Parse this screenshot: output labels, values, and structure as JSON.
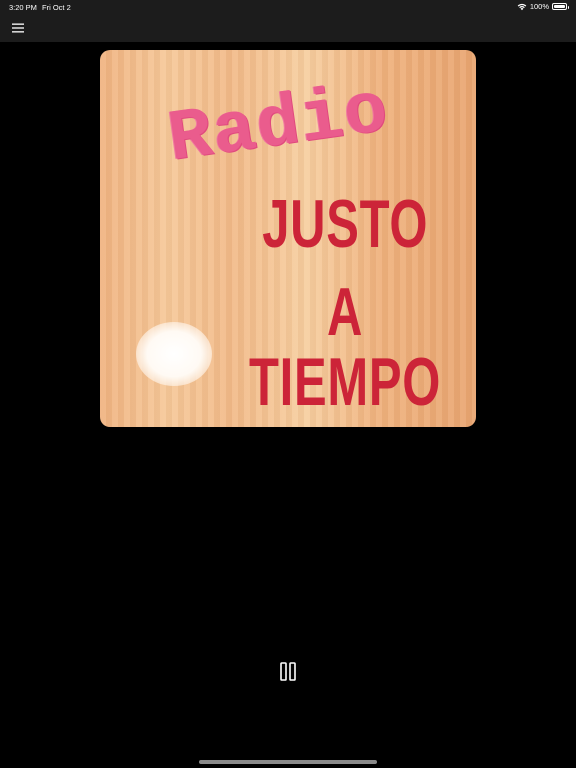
{
  "status_bar": {
    "time": "3:20 PM",
    "date": "Fri Oct 2",
    "battery": "100%",
    "icons": [
      "wifi-icon",
      "battery-icon"
    ]
  },
  "nav": {
    "menu_icon": "hamburger-menu-icon"
  },
  "artwork": {
    "title_word": "Radio",
    "line1": "JUSTO",
    "line2": "A",
    "line3": "TIEMPO"
  },
  "player": {
    "control_icon": "pause-icon"
  },
  "colors": {
    "background": "#000000",
    "bar_background": "#1c1c1c",
    "radio_pink": "#ea5c8d",
    "stencil_red": "#cc2438",
    "wood": "#f2bb8a"
  }
}
